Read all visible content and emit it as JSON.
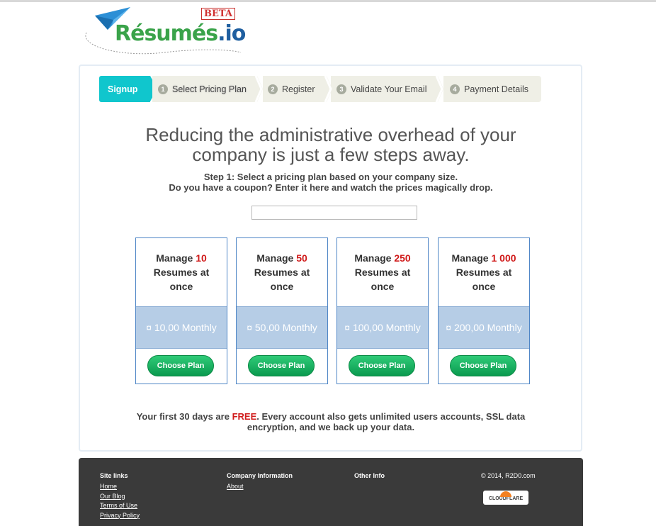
{
  "logo": {
    "word_part1": "Résumés",
    "word_part2": ".io",
    "badge": "BETA"
  },
  "steps": [
    {
      "label": "Signup"
    },
    {
      "num": "1",
      "label": "Select Pricing Plan"
    },
    {
      "num": "2",
      "label": "Register"
    },
    {
      "num": "3",
      "label": "Validate Your Email"
    },
    {
      "num": "4",
      "label": "Payment Details"
    }
  ],
  "headline": [
    "Reducing the administrative overhead of your",
    "company is just a few steps away."
  ],
  "instructions": [
    "Step 1:  Select a pricing plan based on your company size.",
    "Do you have a coupon? Enter it here and watch the prices magically drop."
  ],
  "coupon": {
    "value": ""
  },
  "plans": [
    {
      "prefix": "Manage",
      "count": "10",
      "suffix1": "Resumes at",
      "suffix2": "once",
      "price": "¤ 10,00 Monthly",
      "button": "Choose Plan"
    },
    {
      "prefix": "Manage",
      "count": "50",
      "suffix1": "Resumes at",
      "suffix2": "once",
      "price": "¤ 50,00 Monthly",
      "button": "Choose Plan"
    },
    {
      "prefix": "Manage",
      "count": "250",
      "suffix1": "Resumes at",
      "suffix2": "once",
      "price": "¤ 100,00 Monthly",
      "button": "Choose Plan"
    },
    {
      "prefix": "Manage",
      "count": "1 000",
      "suffix1": "Resumes at",
      "suffix2": "once",
      "price": "¤ 200,00 Monthly",
      "button": "Choose Plan"
    }
  ],
  "footnote": {
    "pre": "Your first 30 days are ",
    "free": "FREE",
    "post": ". Every account also gets unlimited users accounts, SSL data",
    "line2": "encryption, and we back up your data."
  },
  "footer": {
    "site_links": {
      "heading": "Site links",
      "links": [
        "Home",
        "Our Blog",
        "Terms of Use",
        "Privacy Policy"
      ]
    },
    "company": {
      "heading": "Company Information",
      "links": [
        "About"
      ]
    },
    "other": {
      "heading": "Other Info"
    },
    "copyright": "© 2014, R2D0.com",
    "badge": "CLOUDFLARE"
  },
  "colors": {
    "accent": "#10c6cd",
    "brand_green": "#3aa34a",
    "brand_blue": "#1f5fa0",
    "highlight_red": "#d01a1a",
    "button_green": "#0a9a4f",
    "price_bg": "#b6cde6"
  }
}
